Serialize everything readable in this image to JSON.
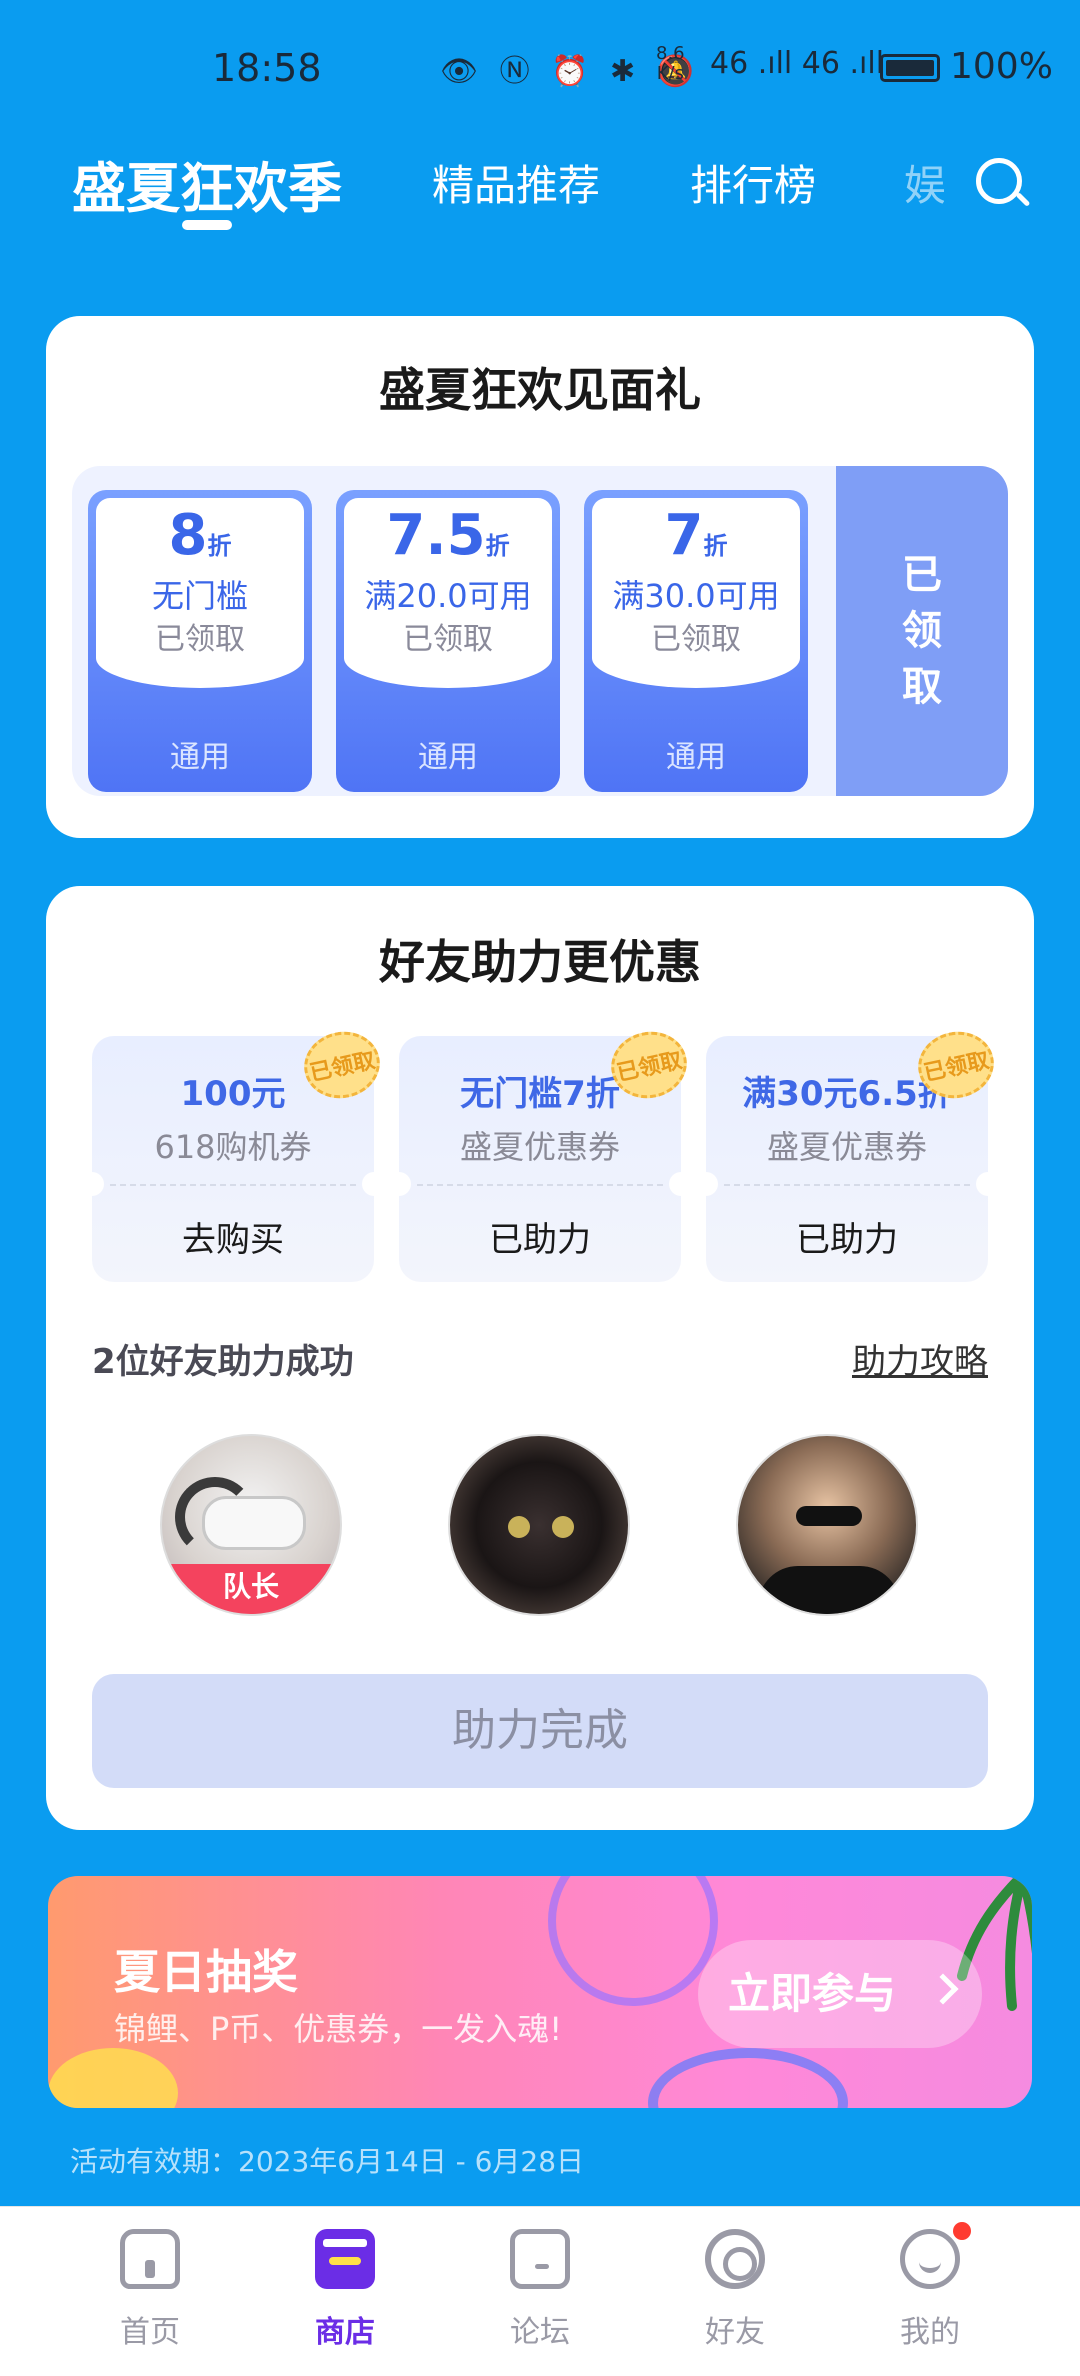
{
  "status_bar": {
    "time": "18:58",
    "net_speed": "8.6\nK/s",
    "signal": "46 .ıll 46 .ıll",
    "battery_pct": "100%"
  },
  "tabs": {
    "items": [
      "盛夏狂欢季",
      "精品推荐",
      "排行榜",
      "娱"
    ],
    "active_index": 0
  },
  "welcome_gift": {
    "title": "盛夏狂欢见面礼",
    "coupons": [
      {
        "value": "8",
        "unit": "折",
        "condition": "无门槛",
        "status": "已领取",
        "scope": "通用"
      },
      {
        "value": "7.5",
        "unit": "折",
        "condition": "满20.0可用",
        "status": "已领取",
        "scope": "通用"
      },
      {
        "value": "7",
        "unit": "折",
        "condition": "满30.0可用",
        "status": "已领取",
        "scope": "通用"
      }
    ],
    "claim_all_label": "已领取"
  },
  "friend_help": {
    "title": "好友助力更优惠",
    "vouchers": [
      {
        "main": "100元",
        "sub": "618购机券",
        "action": "去购买",
        "stamp": "已领取"
      },
      {
        "main": "无门槛7折",
        "sub": "盛夏优惠券",
        "action": "已助力",
        "stamp": "已领取"
      },
      {
        "main": "满30元6.5折",
        "sub": "盛夏优惠券",
        "action": "已助力",
        "stamp": "已领取"
      }
    ],
    "help_count": "2位好友助力成功",
    "guide_link": "助力攻略",
    "captain_label": "队长",
    "done_button": "助力完成"
  },
  "banner": {
    "title": "夏日抽奖",
    "subtitle": "锦鲤、P币、优惠券，一发入魂!",
    "cta": "立即参与"
  },
  "validity": "活动有效期：2023年6月14日 - 6月28日",
  "bottom_nav": [
    {
      "label": "首页",
      "icon": "home-icon"
    },
    {
      "label": "商店",
      "icon": "store-icon"
    },
    {
      "label": "论坛",
      "icon": "forum-icon"
    },
    {
      "label": "好友",
      "icon": "friends-icon"
    },
    {
      "label": "我的",
      "icon": "me-icon"
    }
  ],
  "colors": {
    "background": "#0a9cf0",
    "coupon_blue": "#3a66e8",
    "nav_active": "#6b2de6",
    "captain_red": "#f4435e"
  }
}
